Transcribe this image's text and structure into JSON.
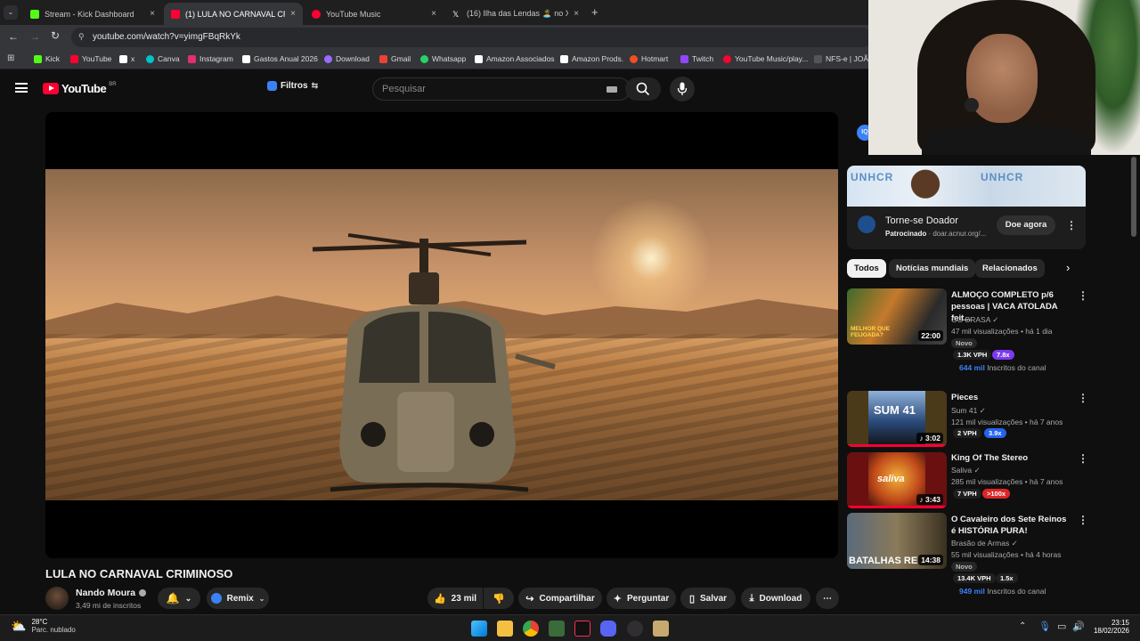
{
  "browser": {
    "tabs": [
      {
        "title": "Stream - Kick Dashboard",
        "active": false,
        "color": "#53fc18"
      },
      {
        "title": "(1) LULA NO CARNAVAL CRIMI",
        "active": true,
        "color": "#ff0033"
      },
      {
        "title": "YouTube Music",
        "active": false,
        "color": "#ff0033"
      },
      {
        "title": "(16) Ilha das Lendas 🏝️ no X: \"",
        "active": false,
        "color": "#ffffff"
      }
    ],
    "url": "youtube.com/watch?v=yimgFBqRkYk",
    "bookmarks": [
      "Kick",
      "YouTube",
      "x",
      "Canva",
      "Instagram",
      "Gastos Anual 2026",
      "Download",
      "Gmail",
      "Whatsapp",
      "Amazon Associados",
      "Amazon Prods.",
      "Hotmart",
      "Twitch",
      "YouTube Music/play...",
      "NFS-e | JOÃO"
    ]
  },
  "youtube": {
    "logo": "YouTube",
    "region": "BR",
    "filters_label": "Filtros",
    "search_placeholder": "Pesquisar"
  },
  "video": {
    "title": "LULA NO CARNAVAL CRIMINOSO",
    "channel": "Nando Moura",
    "subscribers": "3,49 mi de inscritos",
    "remix_label": "Remix",
    "likes": "23 mil",
    "share_label": "Compartilhar",
    "ask_label": "Perguntar",
    "save_label": "Salvar",
    "download_label": "Download"
  },
  "ad": {
    "title": "Torne-se Doador",
    "sponsored": "Patrocinado",
    "domain": "doar.acnur.org/...",
    "cta": "Doe agora",
    "brand": "UNHCR"
  },
  "chips": [
    "Todos",
    "Notícias mundiais",
    "Relacionados"
  ],
  "recommendations": [
    {
      "title": "ALMOÇO COMPLETO p/6 pessoas | VACA ATOLADA feit...",
      "channel": "GG BRASA",
      "meta": "47 mil visualizações • há 1 dia",
      "tag": "Novo",
      "vph": "1.3K VPH",
      "mult": "7.8x",
      "subs_num": "644 mil",
      "subs_label": "Inscritos do canal",
      "duration": "22:00",
      "thumb_text": "MELHOR QUE FEIJOADA?"
    },
    {
      "title": "Pieces",
      "channel": "Sum 41",
      "meta": "121 mil visualizações • há 7 anos",
      "vph": "2 VPH",
      "mult": "3.9x",
      "duration": "3:02",
      "thumb_text": "SUM 41"
    },
    {
      "title": "King Of The Stereo",
      "channel": "Saliva",
      "meta": "285 mil visualizações • há 7 anos",
      "vph": "7 VPH",
      "mult": ">100x",
      "duration": "3:43",
      "thumb_text": "saliva"
    },
    {
      "title": "O Cavaleiro dos Sete Reinos é HISTÓRIA PURA!",
      "channel": "Brasão de Armas",
      "meta": "55 mil visualizações • há 4 horas",
      "tag": "Novo",
      "vph": "13.4K VPH",
      "mult": "1.5x",
      "subs_num": "949 mil",
      "subs_label": "Inscritos do canal",
      "duration": "14:38",
      "thumb_text": "BATALHAS RE"
    }
  ],
  "taskbar": {
    "temp": "28°C",
    "weather": "Parc. nublado",
    "time": "23:15",
    "date": "18/02/2026"
  }
}
